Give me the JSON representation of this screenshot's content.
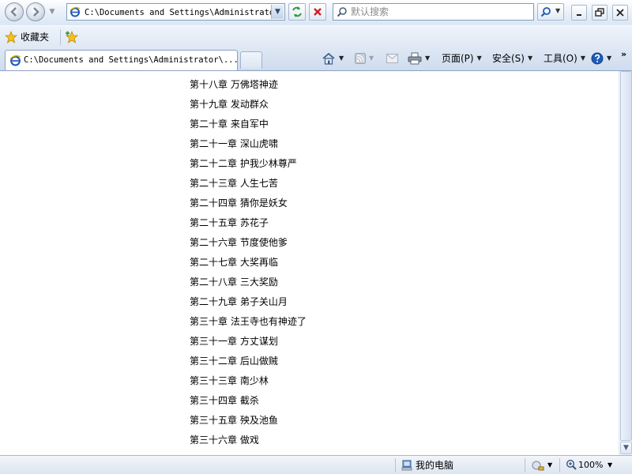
{
  "window": {
    "address": "C:\\Documents and Settings\\Administrator",
    "search_placeholder": "默认搜索"
  },
  "favorites": {
    "label": "收藏夹"
  },
  "tab": {
    "title": "C:\\Documents and Settings\\Administrator\\..."
  },
  "command_bar": {
    "page": "页面(P)",
    "safety": "安全(S)",
    "tools": "工具(O)"
  },
  "chapters": [
    "第十八章 万佛塔神迹",
    "第十九章 发动群众",
    "第二十章 来自军中",
    "第二十一章 深山虎啸",
    "第二十二章 护我少林尊严",
    "第二十三章 人生七苦",
    "第二十四章 猜你是妖女",
    "第二十五章 苏花子",
    "第二十六章 节度使他爹",
    "第二十七章 大奖再临",
    "第二十八章 三大奖励",
    "第二十九章 弟子关山月",
    "第三十章 法王寺也有神迹了",
    "第三十一章 方丈谋划",
    "第三十二章 后山做贼",
    "第三十三章 南少林",
    "第三十四章 截杀",
    "第三十五章 殃及池鱼",
    "第三十六章 做戏"
  ],
  "status": {
    "zone": "我的电脑",
    "zoom": "100%"
  },
  "colors": {
    "ie_blue": "#1e5bb8",
    "close_red": "#d02020",
    "refresh_green": "#2f9a3a"
  }
}
